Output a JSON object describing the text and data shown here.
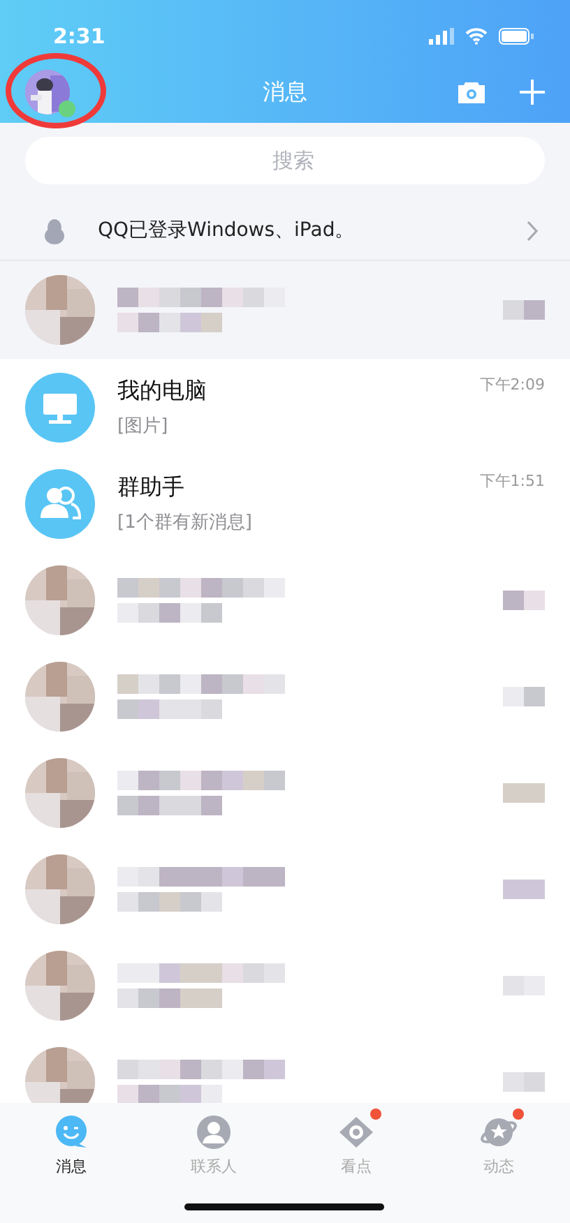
{
  "status_bar": {
    "time": "2:31"
  },
  "header": {
    "title": "消息",
    "avatar_online": true,
    "highlight_circle": true
  },
  "search": {
    "placeholder": "搜索"
  },
  "login_notice": {
    "text": "QQ已登录Windows、iPad。"
  },
  "conversations": [
    {
      "kind": "blurred",
      "pinned": true
    },
    {
      "kind": "computer",
      "pinned": false,
      "name": "我的电脑",
      "preview": "[图片]",
      "time": "下午2:09"
    },
    {
      "kind": "group_helper",
      "pinned": false,
      "name": "群助手",
      "preview": "[1个群有新消息]",
      "time": "下午1:51"
    },
    {
      "kind": "blurred",
      "pinned": false
    },
    {
      "kind": "blurred",
      "pinned": false
    },
    {
      "kind": "blurred",
      "pinned": false
    },
    {
      "kind": "blurred",
      "pinned": false
    },
    {
      "kind": "blurred",
      "pinned": false
    },
    {
      "kind": "blurred",
      "pinned": false
    }
  ],
  "tabs": [
    {
      "kind": "chat",
      "label": "消息",
      "selected": true,
      "badge": false
    },
    {
      "kind": "contacts",
      "label": "联系人",
      "selected": false,
      "badge": false
    },
    {
      "kind": "watch",
      "label": "看点",
      "selected": false,
      "badge": true
    },
    {
      "kind": "feed",
      "label": "动态",
      "selected": false,
      "badge": true
    }
  ]
}
